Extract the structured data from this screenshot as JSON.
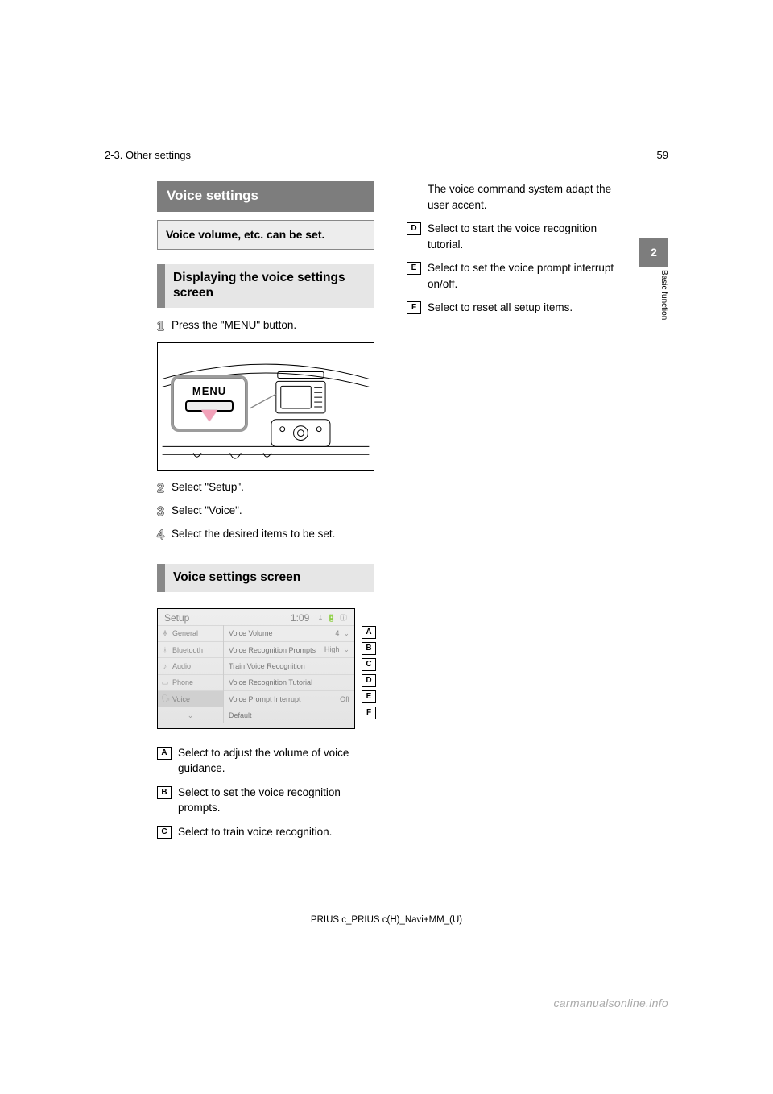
{
  "page": {
    "number": "59",
    "section_path": "2-3. Other settings",
    "chapter_tab": "2",
    "chapter_tab_label": "Basic function"
  },
  "topic": {
    "title": "Voice settings",
    "lead": "Voice volume, etc. can be set."
  },
  "displaying": {
    "heading": "Displaying the voice settings screen",
    "steps": {
      "s1": "Press the \"MENU\" button.",
      "s2": "Select \"Setup\".",
      "s3": "Select \"Voice\".",
      "s4": "Select the desired items to be set."
    },
    "menu_label": "MENU"
  },
  "screen": {
    "heading": "Voice settings screen",
    "topbar": {
      "title": "Setup",
      "time": "1:09",
      "status": "⇣  🔋 ⓘ"
    },
    "left_menu": {
      "general": "General",
      "bluetooth": "Bluetooth",
      "audio": "Audio",
      "phone": "Phone",
      "voice": "Voice",
      "more": "⌄"
    },
    "rows": {
      "a": {
        "label": "Voice Volume",
        "value": "4",
        "chev": "⌄"
      },
      "b": {
        "label": "Voice Recognition Prompts",
        "value": "High",
        "chev": "⌄"
      },
      "c": {
        "label": "Train Voice Recognition",
        "value": ""
      },
      "d": {
        "label": "Voice Recognition Tutorial",
        "value": ""
      },
      "e": {
        "label": "Voice Prompt Interrupt",
        "value": "Off"
      },
      "f": {
        "label": "Default",
        "value": ""
      }
    },
    "callouts": {
      "a": "A",
      "b": "B",
      "c": "C",
      "d": "D",
      "e": "E",
      "f": "F"
    }
  },
  "defs_left": {
    "a": "Select to adjust the volume of voice guidance.",
    "b": "Select to set the voice recognition prompts.",
    "c": "Select to train voice recognition."
  },
  "defs_right": {
    "c_sub": "The voice command system adapt the user accent.",
    "d": "Select to start the voice recognition tutorial.",
    "e": "Select to set the voice prompt interrupt on/off.",
    "f": "Select to reset all setup items."
  },
  "footer": "PRIUS c_PRIUS c(H)_Navi+MM_(U)",
  "watermark": "carmanualsonline.info"
}
